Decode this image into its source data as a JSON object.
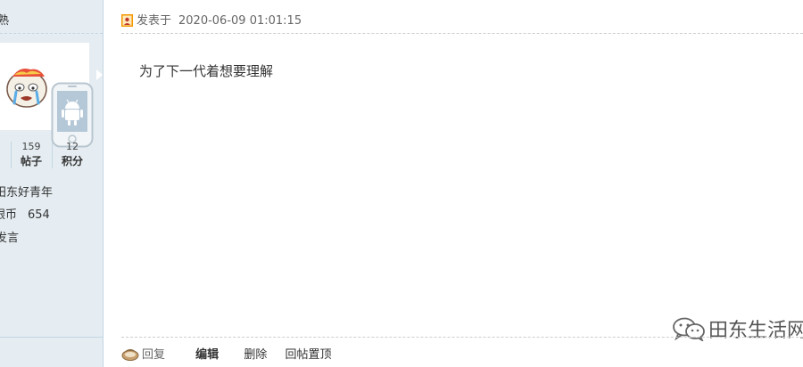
{
  "author": {
    "name_fragment": "熟",
    "stats": [
      {
        "value": "159",
        "label": "帖子"
      },
      {
        "value": "12",
        "label": "积分"
      }
    ],
    "group": "田东好青年",
    "coins_label": "银币",
    "coins_value": "654",
    "action_link": "发言"
  },
  "post": {
    "posted_label": "发表于",
    "timestamp": "2020-06-09 01:01:15",
    "content": "为了下一代着想要理解"
  },
  "watermark": {
    "text": "田东生活网"
  },
  "footer": {
    "reply_label": "回复",
    "edit_label": "编辑",
    "delete_label": "删除",
    "pin_label": "回帖置顶"
  },
  "icons": {
    "post_icon": "post-author-icon",
    "reply_icon": "reply-icon",
    "device_icon": "android-phone-icon",
    "watermark_icon": "wechat-icon"
  },
  "colors": {
    "sidebar_bg": "#e5edf2",
    "border": "#c2d5e3",
    "accent_orange": "#f39800"
  }
}
